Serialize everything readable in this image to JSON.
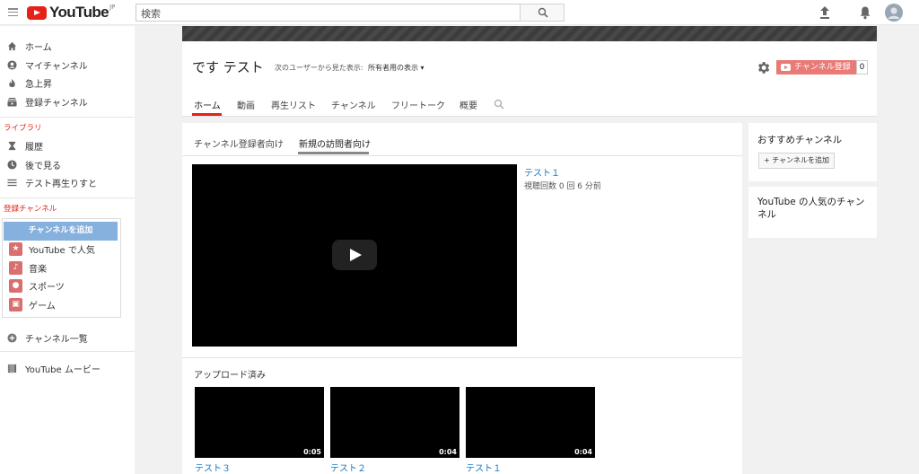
{
  "header": {
    "logo_text": "YouTube",
    "region": "JP",
    "search_placeholder": "検索"
  },
  "guide": {
    "main_items": [
      {
        "label": "ホーム",
        "icon": "home-icon"
      },
      {
        "label": "マイチャンネル",
        "icon": "account-icon"
      },
      {
        "label": "急上昇",
        "icon": "flame-icon"
      },
      {
        "label": "登録チャンネル",
        "icon": "subscriptions-icon"
      }
    ],
    "library_title": "ライブラリ",
    "library_items": [
      {
        "label": "履歴",
        "icon": "hourglass-icon"
      },
      {
        "label": "後で見る",
        "icon": "clock-icon"
      },
      {
        "label": "テスト再生りすと",
        "icon": "playlist-icon"
      }
    ],
    "subscriptions_title": "登録チャンネル",
    "add_channel": "チャンネルを追加",
    "suggested": [
      {
        "label": "YouTube で人気",
        "icon": "star-icon"
      },
      {
        "label": "音楽",
        "icon": "music-icon"
      },
      {
        "label": "スポーツ",
        "icon": "sports-icon"
      },
      {
        "label": "ゲーム",
        "icon": "gaming-icon"
      }
    ],
    "browse_channels": "チャンネル一覧",
    "movies": "YouTube ムービー"
  },
  "channel": {
    "title": "です テスト",
    "view_as_label": "次のユーザーから見た表示:",
    "view_as_value": "所有者用の表示 ▾",
    "subscribe_label": "チャンネル登録",
    "subscriber_count": "0",
    "tabs": [
      "ホーム",
      "動画",
      "再生リスト",
      "チャンネル",
      "フリートーク",
      "概要"
    ]
  },
  "home": {
    "subtabs": [
      "チャンネル登録者向け",
      "新規の訪問者向け"
    ],
    "featured": {
      "title": "テスト１",
      "meta": "視聴回数 0 回  6 分前"
    },
    "uploads_title": "アップロード済み",
    "uploads": [
      {
        "title": "テスト３",
        "duration": "0:05"
      },
      {
        "title": "テスト２",
        "duration": "0:04"
      },
      {
        "title": "テスト１",
        "duration": "0:04"
      }
    ]
  },
  "sidebar": {
    "recommended_title": "おすすめチャンネル",
    "add_channel_button": "+ チャンネルを追加",
    "popular_title": "YouTube の人気のチャンネル"
  },
  "colors": {
    "brand_red": "#e62117",
    "link_blue": "#167ac6",
    "subscribe_pink": "#e97a76",
    "add_channel_blue": "#86b0dd"
  }
}
